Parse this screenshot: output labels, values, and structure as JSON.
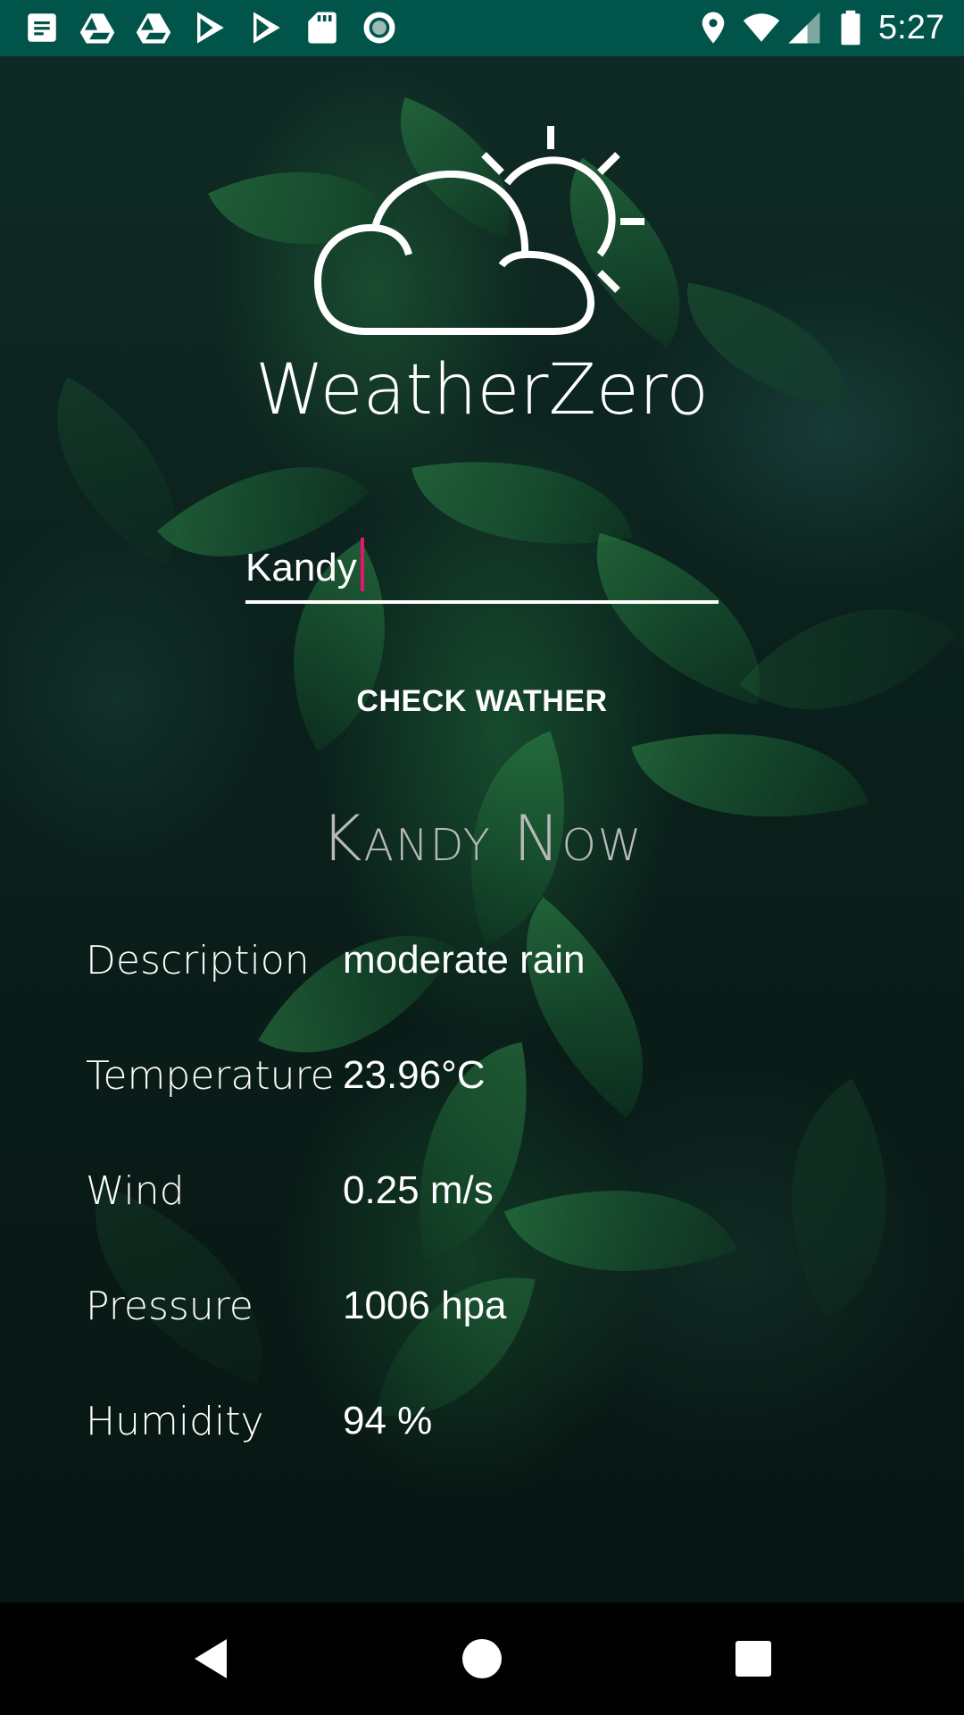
{
  "status_bar": {
    "time": "5:27",
    "left_icons": [
      "notes-icon",
      "drive-icon",
      "drive-icon",
      "play-store-icon",
      "play-store-icon",
      "sd-card-icon",
      "record-icon"
    ],
    "right_icons": [
      "location-icon",
      "wifi-icon",
      "signal-icon",
      "battery-icon"
    ],
    "background_color": "#00544a"
  },
  "app": {
    "title": "WeatherZero",
    "logo_icon": "sun-cloud-icon"
  },
  "search": {
    "value": "Kandy",
    "caret_color": "#e6156a"
  },
  "check_button": {
    "label": "CHECK WATHER"
  },
  "result": {
    "heading": "Kandy Now",
    "rows": [
      {
        "label": "Description",
        "value": "moderate rain"
      },
      {
        "label": "Temperature",
        "value": "23.96°C"
      },
      {
        "label": "Wind",
        "value": "0.25 m/s"
      },
      {
        "label": "Pressure",
        "value": "1006 hpa"
      },
      {
        "label": "Humidity",
        "value": "94 %"
      }
    ]
  },
  "nav_bar": {
    "buttons": [
      "back-icon",
      "home-icon",
      "recents-icon"
    ]
  }
}
